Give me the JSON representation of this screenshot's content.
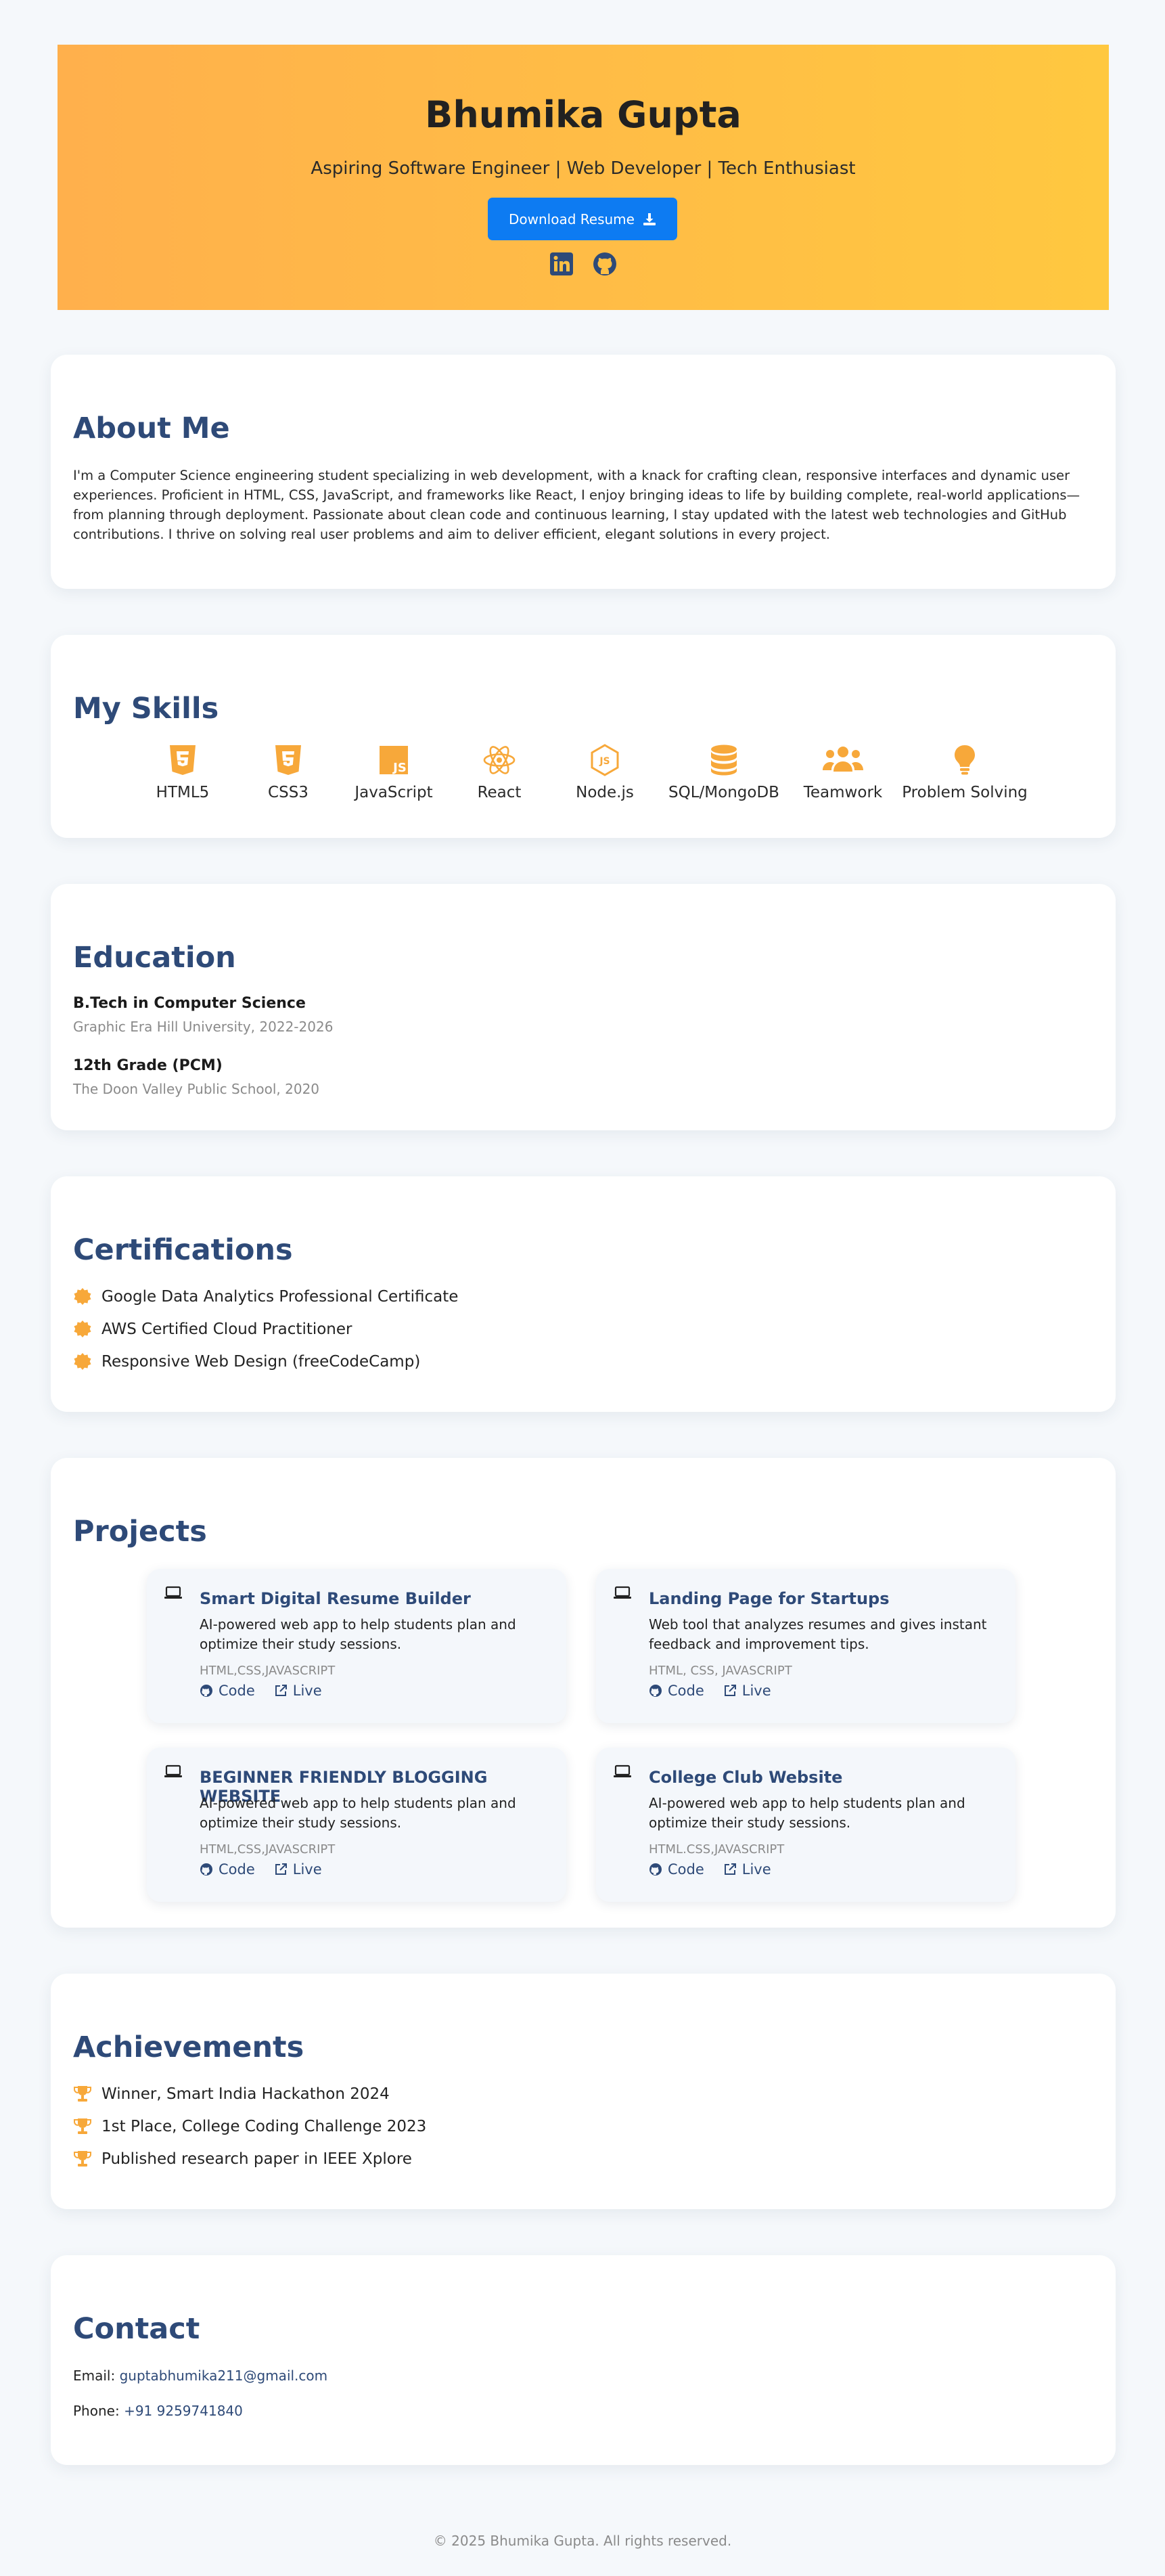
{
  "header": {
    "name": "Bhumika Gupta",
    "tagline": "Aspiring Software Engineer | Web Developer | Tech Enthusiast",
    "download_label": "Download Resume",
    "social_icons": [
      "linkedin-icon",
      "github-icon"
    ],
    "colors": {
      "gradient_start": "#ffb04c",
      "gradient_end": "#ffc840",
      "button": "#0d7bf2"
    }
  },
  "about": {
    "title": "About Me",
    "text": "I'm a Computer Science engineering student specializing in web development, with a knack for crafting clean, responsive interfaces and dynamic user experiences. Proficient in HTML, CSS, JavaScript, and frameworks like React, I enjoy bringing ideas to life by building complete, real-world applications—from planning through deployment. Passionate about clean code and continuous learning, I stay updated with the latest web technologies and GitHub contributions. I thrive on solving real user problems and aim to deliver efficient, elegant solutions in every project."
  },
  "skills": {
    "title": "My Skills",
    "items": [
      {
        "label": "HTML5",
        "icon": "html5-icon"
      },
      {
        "label": "CSS3",
        "icon": "css3-icon"
      },
      {
        "label": "JavaScript",
        "icon": "javascript-icon"
      },
      {
        "label": "React",
        "icon": "react-icon"
      },
      {
        "label": "Node.js",
        "icon": "nodejs-icon"
      },
      {
        "label": "SQL/MongoDB",
        "icon": "database-icon"
      },
      {
        "label": "Teamwork",
        "icon": "users-icon"
      },
      {
        "label": "Problem Solving",
        "icon": "lightbulb-icon"
      }
    ]
  },
  "education": {
    "title": "Education",
    "items": [
      {
        "degree": "B.Tech in Computer Science",
        "school": "Graphic Era Hill University, 2022-2026"
      },
      {
        "degree": "12th Grade (PCM)",
        "school": "The Doon Valley Public School, 2020"
      }
    ]
  },
  "certifications": {
    "title": "Certifications",
    "items": [
      "Google Data Analytics Professional Certificate",
      "AWS Certified Cloud Practitioner",
      "Responsive Web Design (freeCodeCamp)"
    ]
  },
  "projects": {
    "title": "Projects",
    "code_label": "Code",
    "live_label": "Live",
    "items": [
      {
        "title": "Smart Digital Resume Builder",
        "desc": "AI-powered web app to help students plan and optimize their study sessions.",
        "tech": "HTML,CSS,JAVASCRIPT"
      },
      {
        "title": "Landing Page for Startups",
        "desc": "Web tool that analyzes resumes and gives instant feedback and improvement tips.",
        "tech": "HTML, CSS, JAVASCRIPT"
      },
      {
        "title": "BEGINNER FRIENDLY BLOGGING WEBSITE",
        "desc": "AI-powered web app to help students plan and optimize their study sessions.",
        "tech": "HTML,CSS,JAVASCRIPT"
      },
      {
        "title": "College Club Website",
        "desc": "AI-powered web app to help students plan and optimize their study sessions.",
        "tech": "HTML.CSS,JAVASCRIPT"
      }
    ]
  },
  "achievements": {
    "title": "Achievements",
    "items": [
      "Winner, Smart India Hackathon 2024",
      "1st Place, College Coding Challenge 2023",
      "Published research paper in IEEE Xplore"
    ]
  },
  "contact": {
    "title": "Contact",
    "email_label": "Email:",
    "email": "guptabhumika211@gmail.com",
    "phone_label": "Phone:",
    "phone": "+91 9259741840"
  },
  "footer": {
    "text": "© 2025 Bhumika Gupta. All rights reserved."
  },
  "theme": {
    "heading": "#2e4a78",
    "accent": "#f7a83a",
    "muted": "#8a8a8a"
  }
}
